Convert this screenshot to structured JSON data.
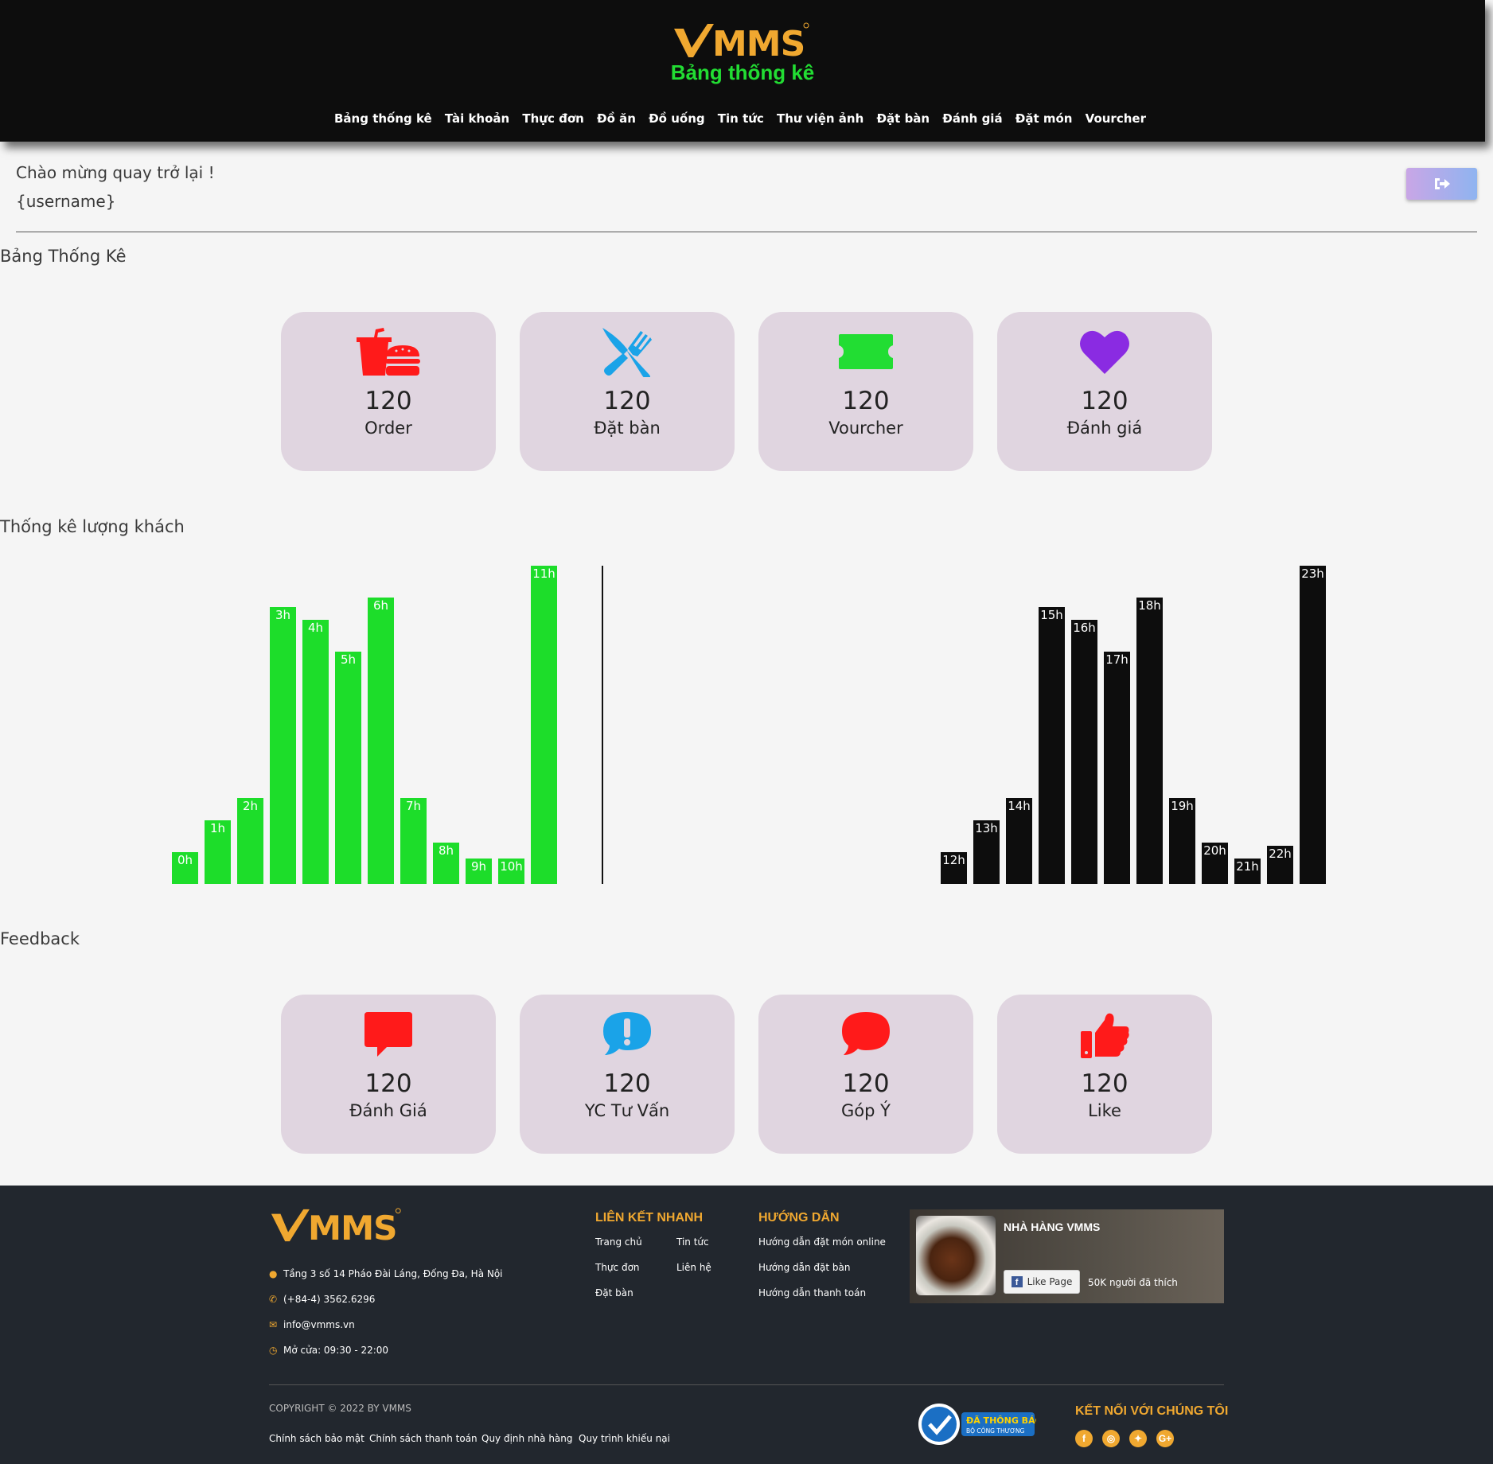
{
  "brand": {
    "logo_text": "VMMS",
    "page_heading": "Bảng thống kê"
  },
  "nav": [
    {
      "label": "Bảng thống kê"
    },
    {
      "label": "Tài khoản"
    },
    {
      "label": "Thực đơn"
    },
    {
      "label": "Đồ ăn"
    },
    {
      "label": "Đồ uống"
    },
    {
      "label": "Tin tức"
    },
    {
      "label": "Thư viện ảnh"
    },
    {
      "label": "Đặt bàn"
    },
    {
      "label": "Đánh giá"
    },
    {
      "label": "Đặt món"
    },
    {
      "label": "Vourcher"
    }
  ],
  "welcome": {
    "line1": "Chào mừng quay trở lại !",
    "line2": "{username}",
    "logout_icon": "sign-out-icon"
  },
  "stats": {
    "title": "Bảng Thống Kê",
    "cards": [
      {
        "icon": "fast-food-icon",
        "color": "#ff1a1a",
        "value": "120",
        "label": "Order"
      },
      {
        "icon": "utensils-icon",
        "color": "#1aa3e8",
        "value": "120",
        "label": "Đặt bàn"
      },
      {
        "icon": "ticket-icon",
        "color": "#22dd33",
        "value": "120",
        "label": "Vourcher"
      },
      {
        "icon": "heart-icon",
        "color": "#8a2be2",
        "value": "120",
        "label": "Đánh giá"
      }
    ]
  },
  "traffic": {
    "title": "Thống kê lượng khách"
  },
  "chart_data": {
    "type": "bar",
    "title": "",
    "xlabel": "",
    "ylabel": "",
    "series": [
      {
        "color": "#1ddd2a",
        "categories": [
          "0h",
          "1h",
          "2h",
          "3h",
          "4h",
          "5h",
          "6h",
          "7h",
          "8h",
          "9h",
          "10h",
          "11h"
        ],
        "values": [
          40,
          80,
          108,
          348,
          332,
          292,
          360,
          108,
          52,
          32,
          32,
          400
        ]
      },
      {
        "color": "#0d0d0d",
        "categories": [
          "12h",
          "13h",
          "14h",
          "15h",
          "16h",
          "17h",
          "18h",
          "19h",
          "20h",
          "21h",
          "22h",
          "23h"
        ],
        "values": [
          40,
          80,
          108,
          348,
          332,
          292,
          360,
          108,
          52,
          32,
          48,
          400
        ]
      }
    ],
    "ylim": [
      0,
      400
    ]
  },
  "feedback": {
    "title": "Feedback",
    "cards": [
      {
        "icon": "comment-alt-icon",
        "color": "#ff1a1a",
        "value": "120",
        "label": "Đánh Giá"
      },
      {
        "icon": "comment-exclamation-icon",
        "color": "#1aa3e8",
        "value": "120",
        "label": "YC Tư Vấn"
      },
      {
        "icon": "comment-icon",
        "color": "#ff1a1a",
        "value": "120",
        "label": "Góp Ý"
      },
      {
        "icon": "thumbs-up-icon",
        "color": "#ff1a1a",
        "value": "120",
        "label": "Like"
      }
    ]
  },
  "footer": {
    "address": "Tầng 3 số 14 Pháo Đài Láng, Đống Đa, Hà Nội",
    "phone": "(+84-4) 3562.6296",
    "email": "info@vmms.vn",
    "hours": "Mở cửa: 09:30 - 22:00",
    "quick_links_title": "LIÊN KẾT NHANH",
    "quick_links": [
      "Trang chủ",
      "Tin tức",
      "Thực đơn",
      "Liên hệ",
      "Đặt bàn"
    ],
    "guide_title": "HƯỚNG DẪN",
    "guides": [
      "Hướng dẫn đặt món online",
      "Hướng dẫn đặt bàn",
      "Hướng dẫn thanh toán"
    ],
    "fb_page": "NHÀ HÀNG VMMS",
    "fb_like": "Like Page",
    "fb_count": "50K người đã thích",
    "copyright": "COPYRIGHT © 2022 BY VMMS",
    "policies": [
      "Chính sách bảo mật",
      "Chính sách thanh toán",
      "Quy định nhà hàng",
      "Quy trình khiếu nại"
    ],
    "badge_line1": "ĐÃ THÔNG BÁO",
    "badge_line2": "BỘ CÔNG THƯƠNG",
    "connect_title": "KẾT NỐI VỚI CHÚNG TÔI",
    "socials": [
      "facebook-icon",
      "instagram-icon",
      "twitter-icon",
      "google-plus-icon"
    ]
  }
}
